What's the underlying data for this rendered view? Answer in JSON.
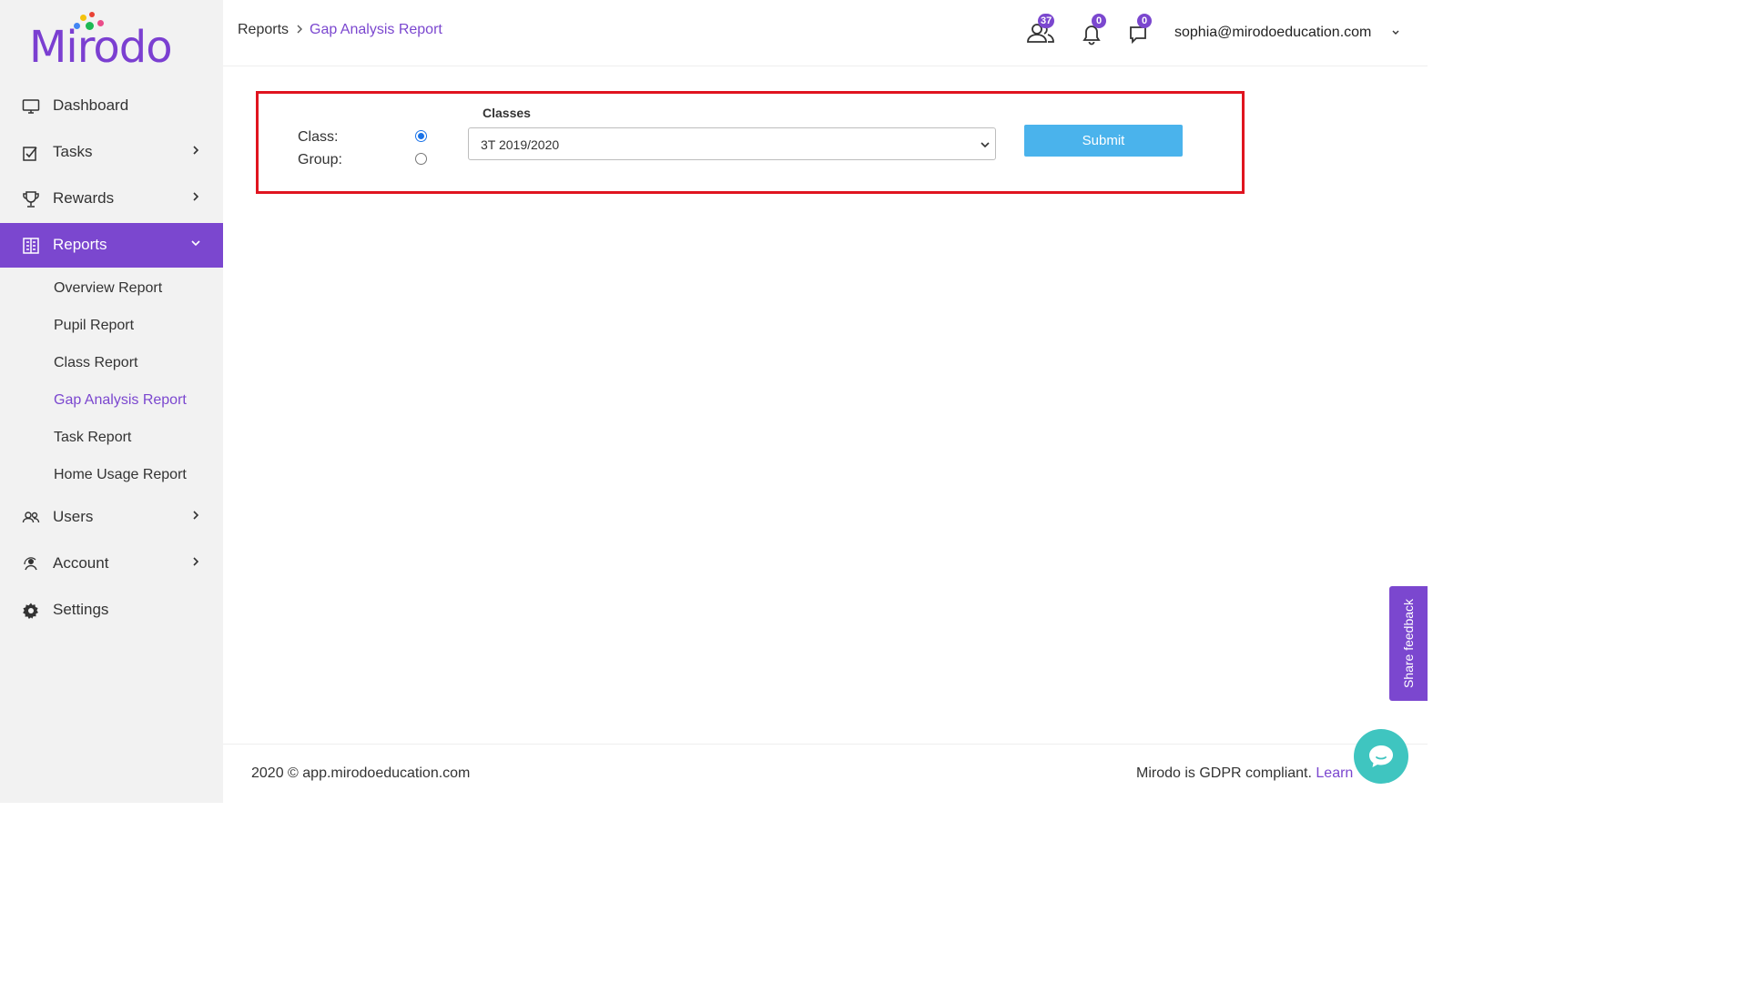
{
  "app": {
    "logo_text": "Mirodo",
    "brand_color": "#7b47cf",
    "logo_dot_colors": [
      "#f4c20d",
      "#e94235",
      "#4285f4",
      "#ea4c89",
      "#1db954"
    ]
  },
  "sidebar": {
    "items": [
      {
        "label": "Dashboard",
        "icon": "monitor-icon"
      },
      {
        "label": "Tasks",
        "icon": "tasks-icon"
      },
      {
        "label": "Rewards",
        "icon": "trophy-icon"
      },
      {
        "label": "Reports",
        "icon": "reports-icon",
        "active": true
      },
      {
        "label": "Users",
        "icon": "users-icon"
      },
      {
        "label": "Account",
        "icon": "account-icon"
      },
      {
        "label": "Settings",
        "icon": "gear-icon"
      }
    ],
    "reports_sub": [
      {
        "label": "Overview Report"
      },
      {
        "label": "Pupil Report"
      },
      {
        "label": "Class Report"
      },
      {
        "label": "Gap Analysis Report",
        "current": true
      },
      {
        "label": "Task Report"
      },
      {
        "label": "Home Usage Report"
      }
    ]
  },
  "header": {
    "breadcrumb": {
      "parent": "Reports",
      "current": "Gap Analysis Report"
    },
    "badges": {
      "users": "37",
      "notifications": "0",
      "messages": "0"
    },
    "user_email": "sophia@mirodoeducation.com"
  },
  "form": {
    "class_label": "Class:",
    "group_label": "Group:",
    "selected_mode": "class",
    "classes_label": "Classes",
    "classes_value": "3T 2019/2020",
    "submit_label": "Submit",
    "highlight_color": "#e0141f",
    "submit_color": "#4ab3ec"
  },
  "footer": {
    "copyright": "2020 © app.mirodoeducation.com",
    "gdpr_text": "Mirodo is GDPR compliant.",
    "gdpr_link": "Learn"
  },
  "widgets": {
    "feedback_label": "Share feedback",
    "chat_color": "#3fc5c0"
  }
}
